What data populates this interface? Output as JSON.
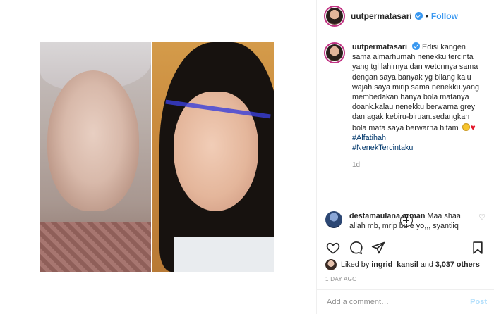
{
  "post": {
    "username": "uutpermatasari",
    "follow_label": "Follow",
    "dot": "•",
    "caption_lines": [
      "Edisi kangen sama",
      "almarhumah nenekku tercinta yang tgl",
      "lahirnya dan wetonnya sama dengan",
      "saya.banyak yg bilang kalu wajah",
      "saya mirip sama nenekku.yang",
      "membedakan hanya bola matanya",
      "doank.kalau nenekku berwarna grey",
      "dan agak kebiru-biruan.sedangkan",
      "bola mata saya berwarna hitam"
    ],
    "hashtags": [
      "#Alfatihah",
      "#NenekTercintaku"
    ],
    "age": "1d"
  },
  "comment": {
    "username": "destamaulana.arman",
    "text_line1": "Maa shaa",
    "text_line2": "allah mb, mrip bu e yo,,, syantiiq"
  },
  "likes": {
    "prefix": "Liked by",
    "user": "ingrid_kansil",
    "suffix": "and",
    "count": "3,037 others"
  },
  "timestamp": "1 DAY AGO",
  "add_comment": {
    "placeholder": "Add a comment…",
    "post_label": "Post"
  },
  "icons": {
    "like": "heart-icon",
    "comment": "comment-icon",
    "share": "share-icon",
    "save": "bookmark-icon",
    "load_more": "plus-circle-icon"
  },
  "colors": {
    "accent": "#3897f0",
    "text": "#262626",
    "muted": "#8e8e8e",
    "post_disabled": "#b2dffc"
  }
}
